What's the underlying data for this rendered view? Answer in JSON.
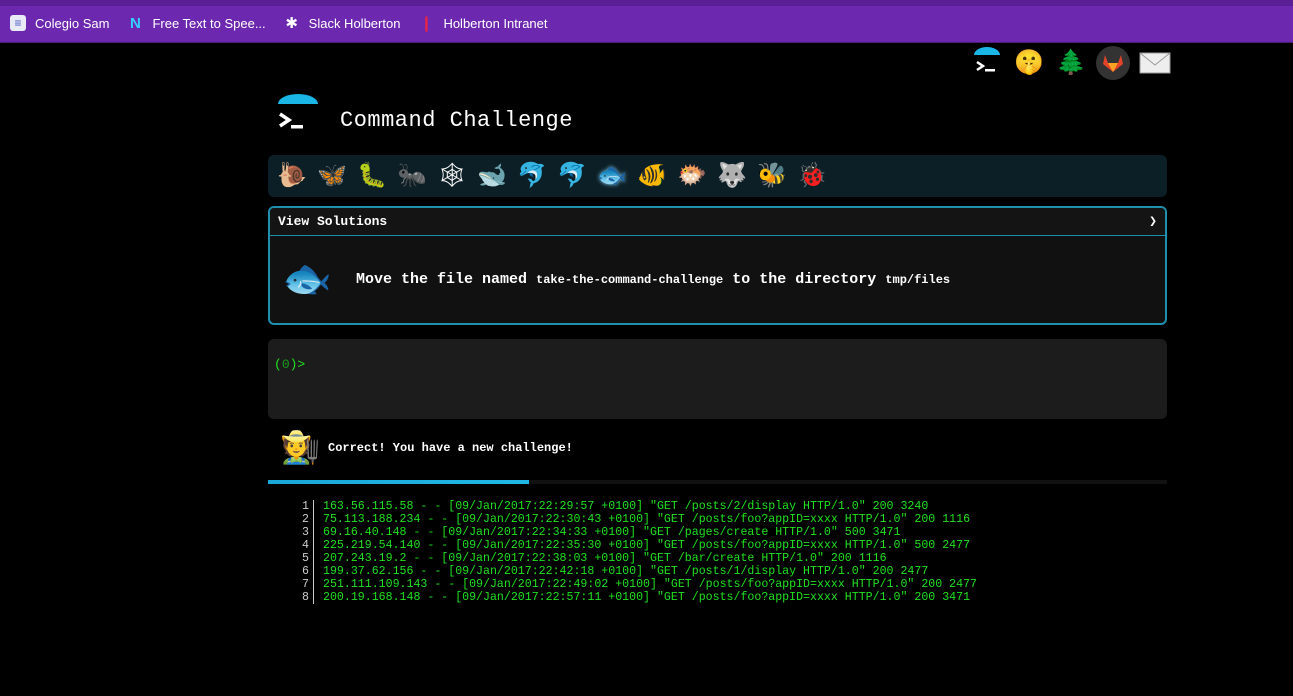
{
  "bookmarks": [
    {
      "label": "Colegio Sam",
      "icon": "docs-icon"
    },
    {
      "label": "Free Text to Spee...",
      "icon": "naturalreader-icon"
    },
    {
      "label": "Slack Holberton",
      "icon": "slack-icon"
    },
    {
      "label": "Holberton Intranet",
      "icon": "holberton-icon"
    }
  ],
  "top_icons": [
    "terminal-icon",
    "shushing-face-icon",
    "tree-icon",
    "gitlab-icon",
    "mail-icon"
  ],
  "header": {
    "title": "Command Challenge"
  },
  "levels": [
    {
      "icon": "snail-icon",
      "glyph": "🐌"
    },
    {
      "icon": "butterfly-icon",
      "glyph": "🦋"
    },
    {
      "icon": "caterpillar-icon",
      "glyph": "🐛"
    },
    {
      "icon": "ant-icon",
      "glyph": "🐜"
    },
    {
      "icon": "spider-web-icon",
      "glyph": "🕸"
    },
    {
      "icon": "whale-icon",
      "glyph": "🐋"
    },
    {
      "icon": "dolphin-icon",
      "glyph": "🐬"
    },
    {
      "icon": "dolphin-2-icon",
      "glyph": "🐬"
    },
    {
      "icon": "fish-icon",
      "glyph": "🐟"
    },
    {
      "icon": "tropical-fish-icon",
      "glyph": "🐠"
    },
    {
      "icon": "blowfish-icon",
      "glyph": "🐡"
    },
    {
      "icon": "wolf-icon",
      "glyph": "🐺"
    },
    {
      "icon": "bee-icon",
      "glyph": "🐝"
    },
    {
      "icon": "ladybug-icon",
      "glyph": "🐞"
    }
  ],
  "challenge": {
    "header_label": "View Solutions",
    "chevron": "❯",
    "text_1": "Move the file named ",
    "code_1": "take-the-command-challenge",
    "text_2": " to the directory ",
    "code_2": "tmp/files"
  },
  "terminal": {
    "prompt_open": "(",
    "exit_code": "0",
    "prompt_close": ")>"
  },
  "result": {
    "message": "Correct! You have a new challenge!",
    "progress": 0.29
  },
  "log_lines": [
    {
      "n": "1",
      "text": "163.56.115.58 - - [09/Jan/2017:22:29:57 +0100] \"GET /posts/2/display HTTP/1.0\" 200 3240"
    },
    {
      "n": "2",
      "text": "75.113.188.234 - - [09/Jan/2017:22:30:43 +0100] \"GET /posts/foo?appID=xxxx HTTP/1.0\" 200 1116"
    },
    {
      "n": "3",
      "text": "69.16.40.148 - - [09/Jan/2017:22:34:33 +0100] \"GET /pages/create HTTP/1.0\" 500 3471"
    },
    {
      "n": "4",
      "text": "225.219.54.140 - - [09/Jan/2017:22:35:30 +0100] \"GET /posts/foo?appID=xxxx HTTP/1.0\" 500 2477"
    },
    {
      "n": "5",
      "text": "207.243.19.2 - - [09/Jan/2017:22:38:03 +0100] \"GET /bar/create HTTP/1.0\" 200 1116"
    },
    {
      "n": "6",
      "text": "199.37.62.156 - - [09/Jan/2017:22:42:18 +0100] \"GET /posts/1/display HTTP/1.0\" 200 2477"
    },
    {
      "n": "7",
      "text": "251.111.109.143 - - [09/Jan/2017:22:49:02 +0100] \"GET /posts/foo?appID=xxxx HTTP/1.0\" 200 2477"
    },
    {
      "n": "8",
      "text": "200.19.168.148 - - [09/Jan/2017:22:57:11 +0100] \"GET /posts/foo?appID=xxxx HTTP/1.0\" 200 3471"
    }
  ],
  "colors": {
    "bookmark_bar": "#6d28b0",
    "accent": "#1f8fae",
    "prompt_green": "#21e021"
  }
}
